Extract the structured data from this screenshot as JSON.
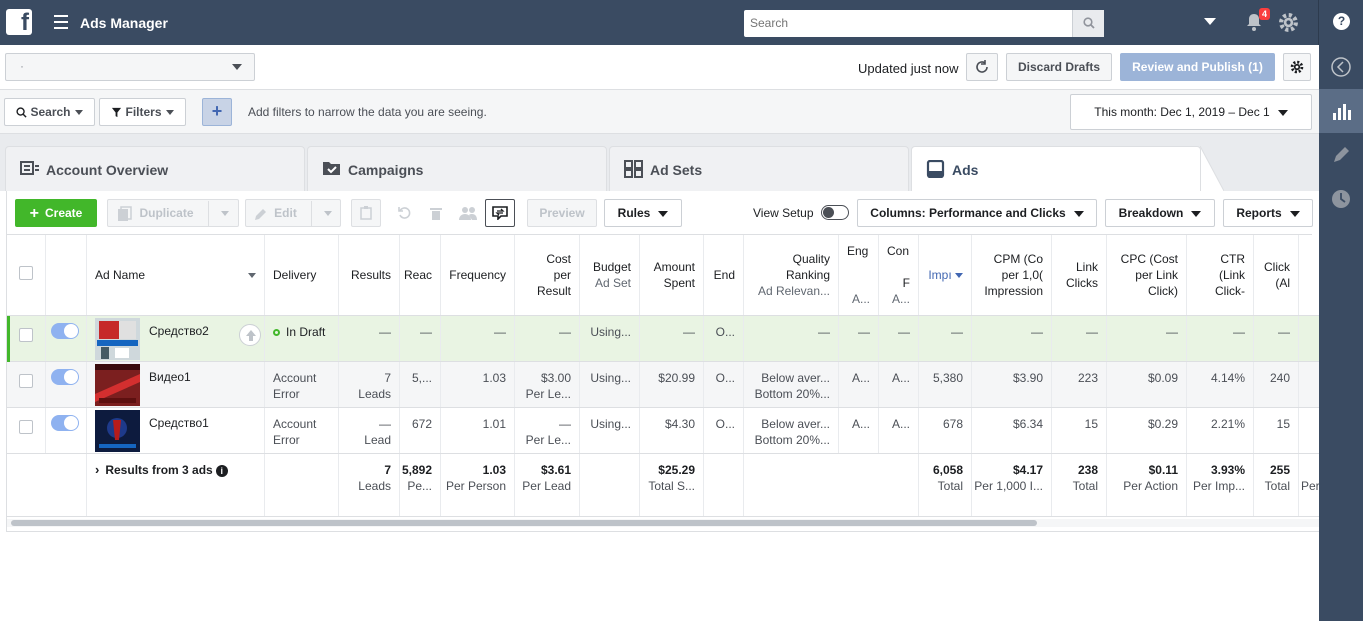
{
  "app": {
    "title": "Ads Manager",
    "logo": "f"
  },
  "topbar": {
    "search_placeholder": "Search",
    "notifications_count": "4",
    "help": "?"
  },
  "account": {
    "selected": "·"
  },
  "status": {
    "updated": "Updated just now"
  },
  "actions": {
    "discard": "Discard Drafts",
    "publish": "Review and Publish (1)"
  },
  "filterbar": {
    "search_label": "Search",
    "filters_label": "Filters",
    "plus": "+",
    "hint": "Add filters to narrow the data you are seeing.",
    "date_range": "This month: Dec 1, 2019 – Dec 1"
  },
  "tabs": [
    {
      "label": "Account Overview"
    },
    {
      "label": "Campaigns"
    },
    {
      "label": "Ad Sets"
    },
    {
      "label": "Ads"
    }
  ],
  "toolbar": {
    "create": "Create",
    "duplicate": "Duplicate",
    "edit": "Edit",
    "preview": "Preview",
    "rules": "Rules",
    "view_setup": "View Setup",
    "columns": "Columns: Performance and Clicks",
    "breakdown": "Breakdown",
    "reports": "Reports"
  },
  "table": {
    "headers": {
      "ad_name": "Ad Name",
      "delivery": "Delivery",
      "results": "Results",
      "reach": "Reac",
      "frequency": "Frequency",
      "cost_l1": "Cost",
      "cost_l2": "per",
      "cost_l3": "Result",
      "budget": "Budget",
      "budget_sub": "Ad Set",
      "amount_l1": "Amount",
      "amount_l2": "Spent",
      "ends": "End",
      "quality_l1": "Quality",
      "quality_l2": "Ranking",
      "quality_sub": "Ad Relevan...",
      "eng_l1": "Eng",
      "eng_sub": "A...",
      "con_l1": "Con",
      "con_l2": "F",
      "con_sub": "A...",
      "impressions": "Impı",
      "cpm_l1": "CPM (Co",
      "cpm_l2": "per 1,0(",
      "cpm_l3": "Impression",
      "link_l1": "Link",
      "link_l2": "Clicks",
      "cpc_l1": "CPC (Cost",
      "cpc_l2": "per Link",
      "cpc_l3": "Click)",
      "ctr_l1": "CTR",
      "ctr_l2": "(Link",
      "ctr_l3": "Click-",
      "clicks_l1": "Click",
      "clicks_l2": "(Al"
    },
    "rows": [
      {
        "name": "Средство2",
        "delivery": "In Draft",
        "results": "—",
        "reach": "—",
        "frequency": "—",
        "cost": "—",
        "budget": "Using...",
        "spent": "—",
        "ends": "O...",
        "quality": "—",
        "eng": "—",
        "con": "—",
        "impressions": "—",
        "cpm": "—",
        "link_clicks": "—",
        "cpc": "—",
        "ctr": "—",
        "clicks": "—"
      },
      {
        "name": "Видео1",
        "delivery_l1": "Account",
        "delivery_l2": "Error",
        "results": "7",
        "results_sub": "Leads",
        "reach": "5,...",
        "frequency": "1.03",
        "cost": "$3.00",
        "cost_sub": "Per Le...",
        "budget": "Using...",
        "spent": "$20.99",
        "ends": "O...",
        "quality": "Below aver...",
        "quality_sub": "Bottom 20%...",
        "eng": "A...",
        "con": "A...",
        "impressions": "5,380",
        "cpm": "$3.90",
        "link_clicks": "223",
        "cpc": "$0.09",
        "ctr": "4.14%",
        "clicks": "240"
      },
      {
        "name": "Средство1",
        "delivery_l1": "Account",
        "delivery_l2": "Error",
        "results": "—",
        "results_sub": "Lead",
        "reach": "672",
        "frequency": "1.01",
        "cost": "—",
        "cost_sub": "Per Le...",
        "budget": "Using...",
        "spent": "$4.30",
        "ends": "O...",
        "quality": "Below aver...",
        "quality_sub": "Bottom 20%...",
        "eng": "A...",
        "con": "A...",
        "impressions": "678",
        "cpm": "$6.34",
        "link_clicks": "15",
        "cpc": "$0.29",
        "ctr": "2.21%",
        "clicks": "15"
      }
    ],
    "totals": {
      "label": "Results from 3 ads",
      "info": "i",
      "results": "7",
      "results_sub": "Leads",
      "reach": "5,892",
      "reach_sub": "Pe...",
      "frequency": "1.03",
      "frequency_sub": "Per Person",
      "cost": "$3.61",
      "cost_sub": "Per Lead",
      "spent": "$25.29",
      "spent_sub": "Total S...",
      "impressions": "6,058",
      "impressions_sub": "Total",
      "cpm": "$4.17",
      "cpm_sub": "Per 1,000 I...",
      "link_clicks": "238",
      "link_clicks_sub": "Total",
      "cpc": "$0.11",
      "cpc_sub": "Per Action",
      "ctr": "3.93%",
      "ctr_sub": "Per Imp...",
      "clicks": "255",
      "clicks_sub": "Total",
      "extra_sub": "Per"
    }
  },
  "colors": {
    "topbar": "#3a4b62",
    "create": "#42b72a",
    "draft": "#e9f4e3",
    "link": "#4267b2"
  }
}
